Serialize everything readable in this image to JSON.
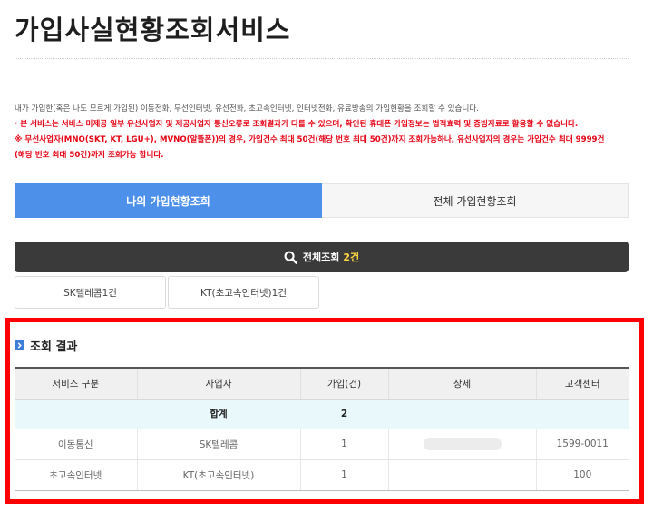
{
  "page": {
    "title": "가입사실현황조회서비스"
  },
  "notice": {
    "line1": "내가 가입한(혹은 나도 모르게 가입된) 이동전화, 무선인터넷, 유선전화, 초고속인터넷, 인터넷전화, 유료방송의 가입현황을 조회할 수 있습니다.",
    "line2": "· 본 서비스는 서비스 미제공 일부 유선사업자 및 제공사업자 통신오류로 조회결과가 다를 수 있으며, 확인된 휴대폰 가입정보는 법적효력 및 증빙자료로 활용할 수 없습니다.",
    "line3": "※ 무선사업자(MNO(SKT, KT, LGU+), MVNO(알뜰폰))의 경우, 가입건수 최대 50건(해당 번호 최대 50건)까지 조회가능하나, 유선사업자의 경우는 가입건수 최대 9999건",
    "line4": "(해당 번호 최대 50건)까지 조회가능 합니다."
  },
  "tabs": [
    {
      "label": "나의 가입현황조회",
      "active": true
    },
    {
      "label": "전체 가입현황조회",
      "active": false
    }
  ],
  "search": {
    "label": "전체조회",
    "count": "2건"
  },
  "filters": [
    "SK텔레콤1건",
    "KT(초고속인터넷)1건"
  ],
  "results": {
    "title": "조회 결과",
    "columns": [
      "서비스 구분",
      "사업자",
      "가입(건)",
      "상세",
      "고객센터"
    ],
    "total": {
      "label": "합계",
      "value": "2"
    },
    "rows": [
      {
        "service": "이동통신",
        "provider": "SK텔레콤",
        "count": "1",
        "center": "1599-0011"
      },
      {
        "service": "초고속인터넷",
        "provider": "KT(초고속인터넷)",
        "count": "1",
        "center": "100"
      }
    ]
  },
  "colors": {
    "accent": "#4d90e9",
    "highlight": "#ff0000",
    "search_bar": "#3a3a3a",
    "count_yellow": "#ffd740"
  }
}
